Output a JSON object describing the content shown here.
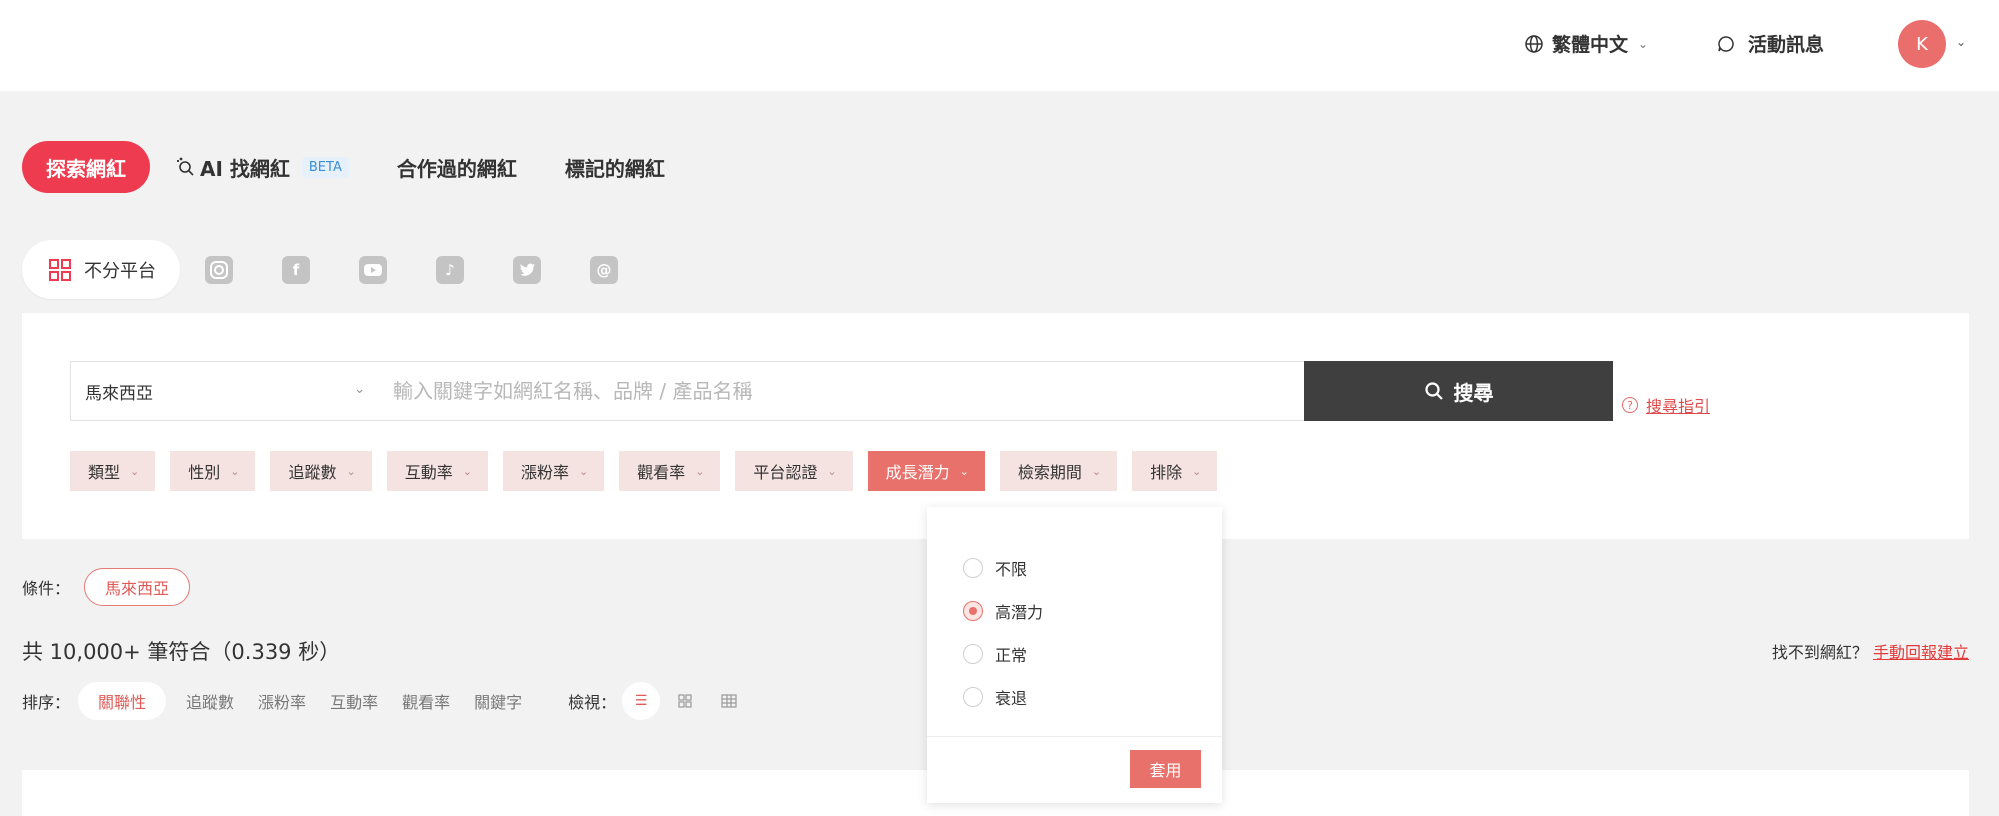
{
  "header": {
    "language": "繁體中文",
    "events": "活動訊息",
    "avatar_initial": "K"
  },
  "tabs": {
    "explore": "探索網紅",
    "ai": "AI 找網紅",
    "beta": "BETA",
    "collaborated": "合作過的網紅",
    "marked": "標記的網紅"
  },
  "platforms": {
    "all": "不分平台",
    "icons": [
      "instagram-icon",
      "facebook-icon",
      "youtube-icon",
      "tiktok-icon",
      "twitter-icon",
      "threads-icon"
    ]
  },
  "search": {
    "country": "馬來西亞",
    "keyword_placeholder": "輸入關鍵字如網紅名稱、品牌 / 產品名稱",
    "button": "搜尋",
    "guide": "搜尋指引"
  },
  "filters": [
    "類型",
    "性別",
    "追蹤數",
    "互動率",
    "漲粉率",
    "觀看率",
    "平台認證",
    "成長潛力",
    "檢索期間",
    "排除"
  ],
  "conditions": {
    "label": "條件：",
    "chip": "馬來西亞"
  },
  "results": {
    "total": "共 10,000+ 筆符合（0.339 秒）",
    "not_found": "找不到網紅？",
    "manual_link": "手動回報建立"
  },
  "sort": {
    "label": "排序：",
    "active": "關聯性",
    "options": [
      "追蹤數",
      "漲粉率",
      "互動率",
      "觀看率",
      "關鍵字"
    ],
    "view_label": "檢視："
  },
  "growth_dropdown": {
    "options": [
      "不限",
      "高潛力",
      "正常",
      "衰退"
    ],
    "selected": "高潛力",
    "apply": "套用"
  },
  "colors": {
    "primary": "#ef3b4f",
    "accent": "#e8716b",
    "dark_button": "#3f3f3f"
  }
}
